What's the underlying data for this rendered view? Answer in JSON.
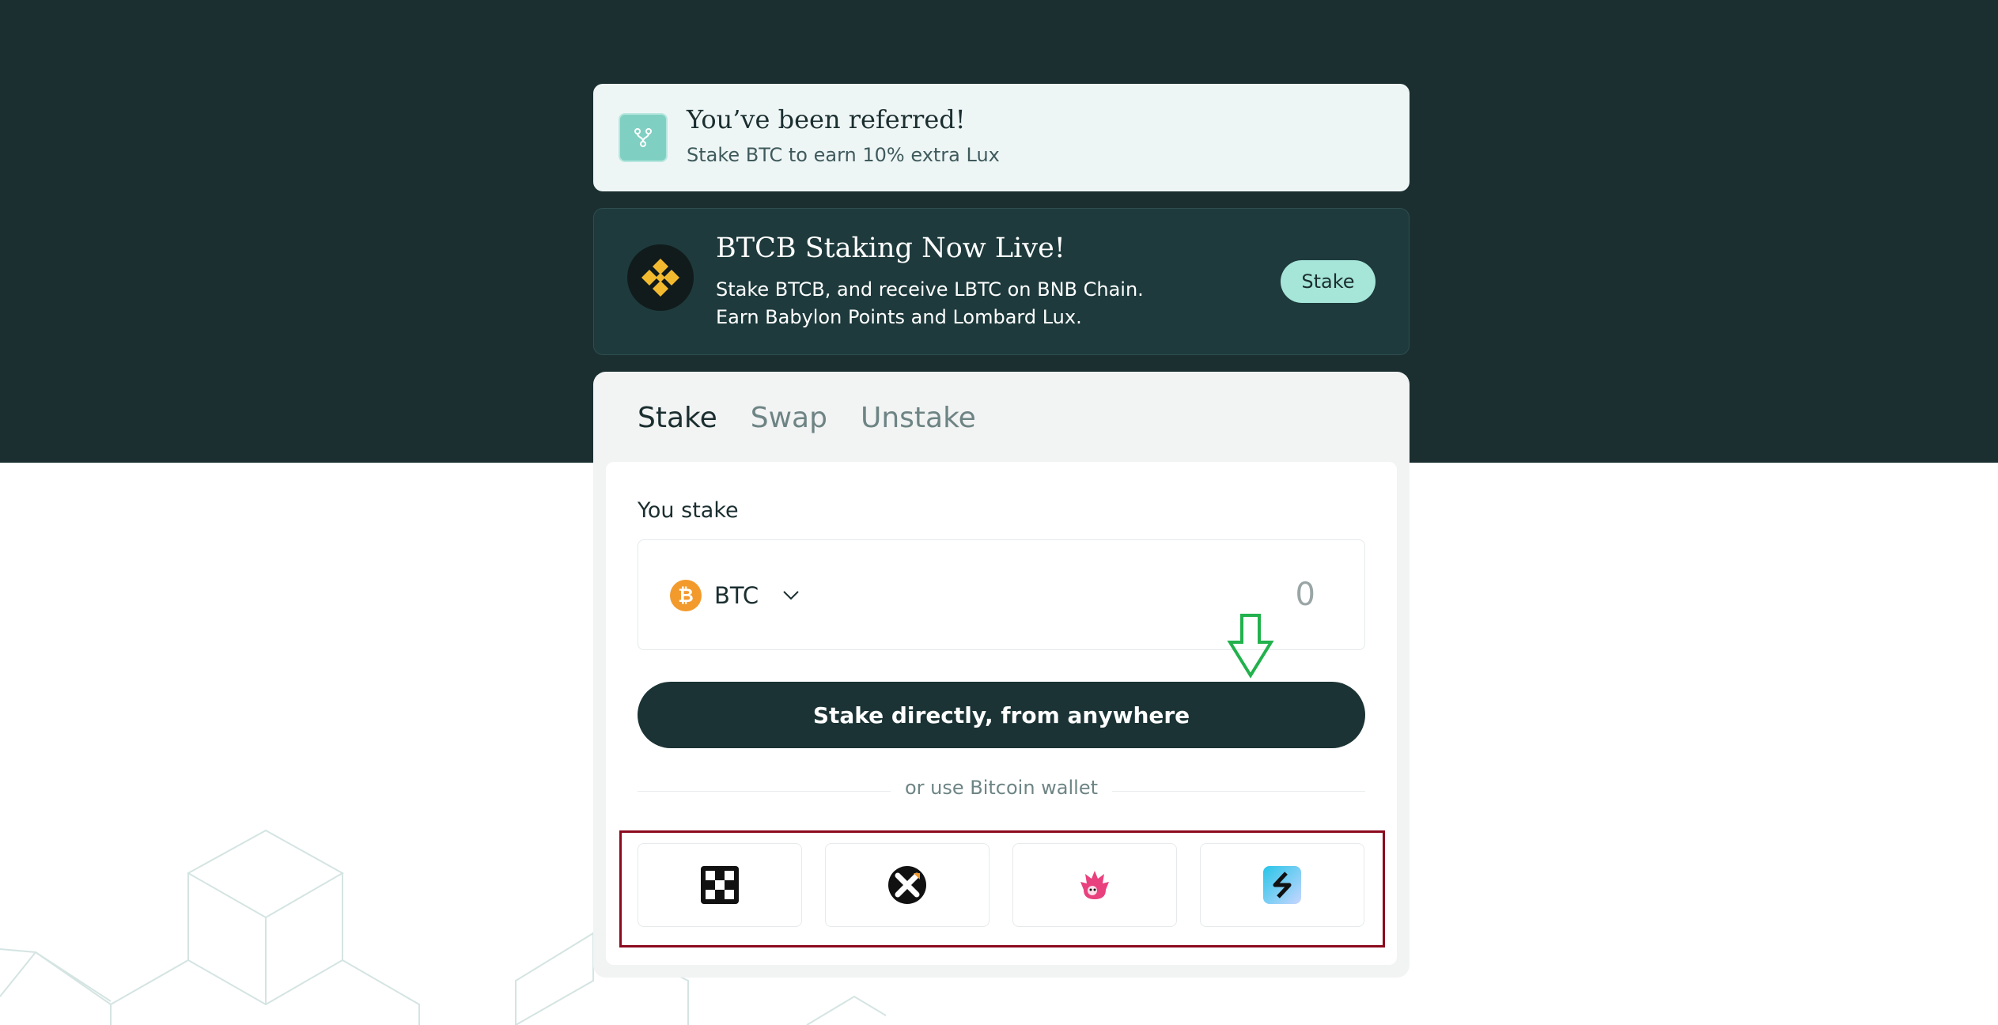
{
  "referral": {
    "title": "You’ve been referred!",
    "subtitle": "Stake BTC to earn 10% extra Lux",
    "icon": "fork-icon"
  },
  "promo": {
    "title": "BTCB Staking Now Live!",
    "line1": "Stake BTCB, and receive LBTC on BNB Chain.",
    "line2": "Earn Babylon Points and Lombard Lux.",
    "button_label": "Stake",
    "icon": "bnb-logo-icon"
  },
  "tabs": [
    {
      "label": "Stake",
      "active": true
    },
    {
      "label": "Swap",
      "active": false
    },
    {
      "label": "Unstake",
      "active": false
    }
  ],
  "stake_form": {
    "label": "You stake",
    "token": "BTC",
    "token_icon": "bitcoin-icon",
    "amount_placeholder": "0",
    "cta_label": "Stake directly, from anywhere",
    "alt_label": "or use Bitcoin wallet"
  },
  "wallets": [
    {
      "icon": "checkered-wallet-icon"
    },
    {
      "icon": "x-wallet-icon"
    },
    {
      "icon": "hedgehog-wallet-icon"
    },
    {
      "icon": "lightning-wallet-icon"
    }
  ],
  "colors": {
    "header_bg": "#1b2f31",
    "promo_bg": "#1e3a3c",
    "accent": "#a6e6d9",
    "cta_bg": "#1b3334",
    "highlight_frame": "#8b0a1e",
    "arrow": "#22b14c",
    "btc": "#f39a2d"
  }
}
